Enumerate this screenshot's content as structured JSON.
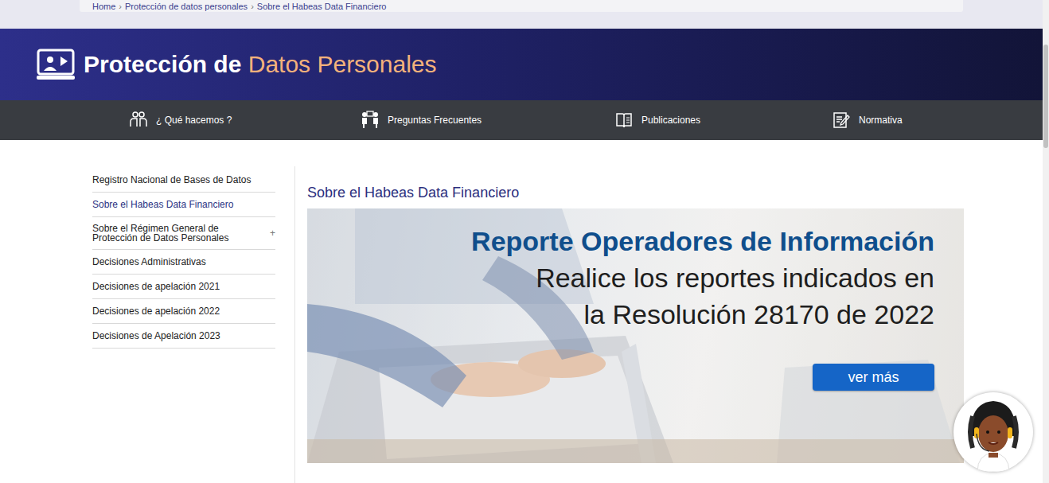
{
  "breadcrumb": {
    "items": [
      "Home",
      "Protección de datos personales",
      "Sobre el Habeas Data Financiero"
    ],
    "separator": "›"
  },
  "header": {
    "title_strong": "Protección de",
    "title_accent": "Datos Personales"
  },
  "nav": [
    {
      "label": "¿ Qué hacemos ?"
    },
    {
      "label": "Preguntas Frecuentes"
    },
    {
      "label": "Publicaciones"
    },
    {
      "label": "Normativa"
    }
  ],
  "sidebar": {
    "items": [
      {
        "label": "Registro Nacional de Bases de Datos",
        "selected": false
      },
      {
        "label": "Sobre el Habeas Data Financiero",
        "selected": true
      },
      {
        "label": "Sobre el Régimen General de Protección de Datos Personales",
        "selected": false,
        "toggle": "+"
      },
      {
        "label": "Decisiones Administrativas",
        "selected": false
      },
      {
        "label": "Decisiones de apelación 2021",
        "selected": false
      },
      {
        "label": "Decisiones de apelación 2022",
        "selected": false
      },
      {
        "label": "Decisiones de Apelación 2023",
        "selected": false
      }
    ]
  },
  "main": {
    "title": "Sobre el Habeas Data Financiero",
    "banner": {
      "heading": "Reporte Operadores de Información",
      "lines": [
        "Realice los reportes indicados en",
        "la Resolución 28170 de 2022"
      ],
      "button": "ver más"
    }
  }
}
